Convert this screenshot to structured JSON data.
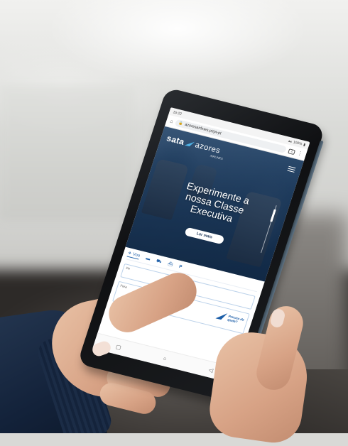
{
  "colors": {
    "brand_blue": "#1c5ea8",
    "hero_navy": "#1a3556",
    "sleeve_navy": "#13223a",
    "skin": "#d7a285"
  },
  "status_bar": {
    "time": "15:22",
    "battery": "100%"
  },
  "browser": {
    "url": "azoresairlines.pt/pt-pt",
    "tab_count": "1"
  },
  "header": {
    "logo_sata": "sata",
    "logo_azores": "azores",
    "logo_sub": "AIRLINES",
    "menu_icon": "hamburger-icon"
  },
  "hero": {
    "title_lines": [
      "Experimente a",
      "nossa Classe",
      "Executiva"
    ],
    "cta_label": "Ler mais"
  },
  "booking": {
    "tabs": [
      {
        "icon": "plane-icon",
        "label": "Voo"
      },
      {
        "icon": "bed-icon",
        "label": ""
      },
      {
        "icon": "car-icon",
        "label": ""
      },
      {
        "icon": "ship-icon",
        "label": ""
      },
      {
        "icon": "parking-icon",
        "label": "P"
      }
    ],
    "from_label": "De",
    "to_label": "Para",
    "promo_line1": "Precisa de",
    "promo_line2": "ajuda?"
  },
  "nav": {
    "back": "◁",
    "home": "○",
    "recent": "▢"
  }
}
